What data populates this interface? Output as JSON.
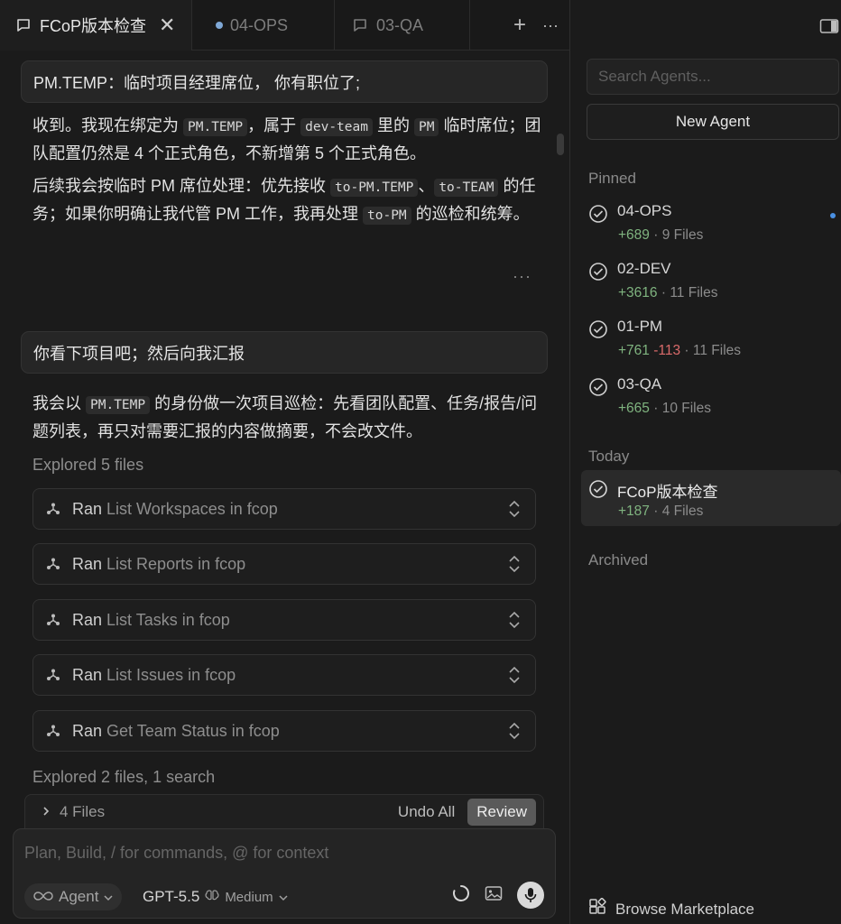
{
  "tabs": [
    {
      "label": "FCoP版本检查",
      "icon": "chat-icon"
    },
    {
      "label": "04-OPS",
      "icon": "dot-icon"
    },
    {
      "label": "03-QA",
      "icon": "chat-icon"
    }
  ],
  "tab_actions": {
    "new": "+",
    "more": "···",
    "close": "✕"
  },
  "chat": {
    "user1": "PM.TEMP：临时项目经理席位， 你有职位了;",
    "reply1": {
      "p1": [
        "收到。我现在绑定为 ",
        "PM.TEMP",
        "，属于 ",
        "dev-team",
        " 里的 ",
        "PM",
        " 临时席位；团队配置仍然是 4 个正式角色，不新增第 5 个正式角色。"
      ],
      "p2": [
        "后续我会按临时 PM 席位处理：优先接收 ",
        "to-PM.TEMP",
        "、",
        "to-TEAM",
        " 的任务；如果你明确让我代管 PM 工作，我再处理 ",
        "to-PM",
        " 的巡检和统筹。"
      ]
    },
    "more": "···",
    "user2": "你看下项目吧；然后向我汇报",
    "reply2": [
      "我会以 ",
      "PM.TEMP",
      " 的身份做一次项目巡检：先看团队配置、任务/报告/问题列表，再只对需要汇报的内容做摘要，不会改文件。"
    ],
    "explored1": "Explored 5 files",
    "tools": [
      {
        "ran": "Ran",
        "label": "List Workspaces in fcop"
      },
      {
        "ran": "Ran",
        "label": "List Reports in fcop"
      },
      {
        "ran": "Ran",
        "label": "List Tasks in fcop"
      },
      {
        "ran": "Ran",
        "label": "List Issues in fcop"
      },
      {
        "ran": "Ran",
        "label": "Get Team Status in fcop"
      }
    ],
    "explored2": "Explored 2 files, 1 search"
  },
  "changes": {
    "files": "4 Files",
    "undo": "Undo All",
    "review": "Review"
  },
  "composer": {
    "placeholder": "Plan, Build, / for commands, @ for context",
    "mode": "Agent",
    "model": "GPT-5.5",
    "effort": "Medium"
  },
  "sidebar": {
    "search_placeholder": "Search Agents...",
    "new_agent": "New Agent",
    "pinned_label": "Pinned",
    "pinned": [
      {
        "name": "04-OPS",
        "add": "+689",
        "del": "",
        "files": "9 Files",
        "unread": true
      },
      {
        "name": "02-DEV",
        "add": "+3616",
        "del": "",
        "files": "11 Files",
        "unread": false
      },
      {
        "name": "01-PM",
        "add": "+761",
        "del": "-113",
        "files": "11 Files",
        "unread": false
      },
      {
        "name": "03-QA",
        "add": "+665",
        "del": "",
        "files": "10 Files",
        "unread": false
      }
    ],
    "today_label": "Today",
    "today": [
      {
        "name": "FCoP版本检查",
        "add": "+187",
        "del": "",
        "files": "4 Files"
      }
    ],
    "archived_label": "Archived",
    "marketplace": "Browse Marketplace"
  },
  "colors": {
    "added": "#7fb37f",
    "removed": "#d96a6a",
    "unread": "#4a90e2"
  }
}
